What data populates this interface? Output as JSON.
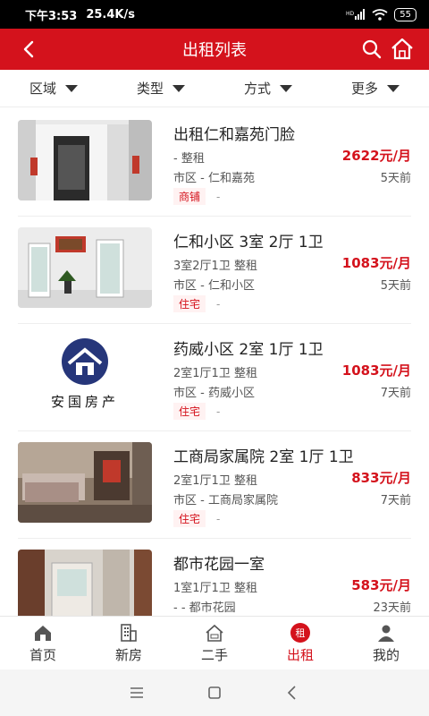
{
  "status_bar": {
    "time": "下午3:53",
    "speed": "25.4K/s",
    "signal": "HD",
    "battery": "55"
  },
  "header": {
    "title": "出租列表",
    "back_icon": "chevron-left-icon",
    "search_icon": "search-icon",
    "home_icon": "home-icon",
    "color": "#d4121c"
  },
  "filters": [
    {
      "label": "区域"
    },
    {
      "label": "类型"
    },
    {
      "label": "方式"
    },
    {
      "label": "更多"
    }
  ],
  "listings": [
    {
      "title": "出租仁和嘉苑门脸",
      "detail": "-  整租",
      "price": "2622元/月",
      "location": "市区 - 仁和嘉苑",
      "time": "5天前",
      "tag": "商铺",
      "tag2": "-"
    },
    {
      "title": "仁和小区 3室 2厅 1卫",
      "detail": "3室2厅1卫  整租",
      "price": "1083元/月",
      "location": "市区 - 仁和小区",
      "time": "5天前",
      "tag": "住宅",
      "tag2": "-"
    },
    {
      "title": "药威小区 2室 1厅 1卫",
      "detail": "2室1厅1卫  整租",
      "price": "1083元/月",
      "location": "市区 - 药威小区",
      "time": "7天前",
      "tag": "住宅",
      "tag2": "-",
      "logo_text": "安国房产"
    },
    {
      "title": "工商局家属院 2室 1厅 1卫",
      "detail": "2室1厅1卫  整租",
      "price": "833元/月",
      "location": "市区 - 工商局家属院",
      "time": "7天前",
      "tag": "住宅",
      "tag2": "-"
    },
    {
      "title": "都市花园一室",
      "detail": "1室1厅1卫  整租",
      "price": "583元/月",
      "location": "- - 都市花园",
      "time": "23天前"
    }
  ],
  "tabbar": [
    {
      "label": "首页",
      "icon": "home-icon"
    },
    {
      "label": "新房",
      "icon": "building-icon"
    },
    {
      "label": "二手",
      "icon": "house-sale-icon"
    },
    {
      "label": "出租",
      "icon": "rent-badge-icon",
      "badge": "租"
    },
    {
      "label": "我的",
      "icon": "user-icon"
    }
  ],
  "active_tab": "出租",
  "price_color": "#d4121c"
}
